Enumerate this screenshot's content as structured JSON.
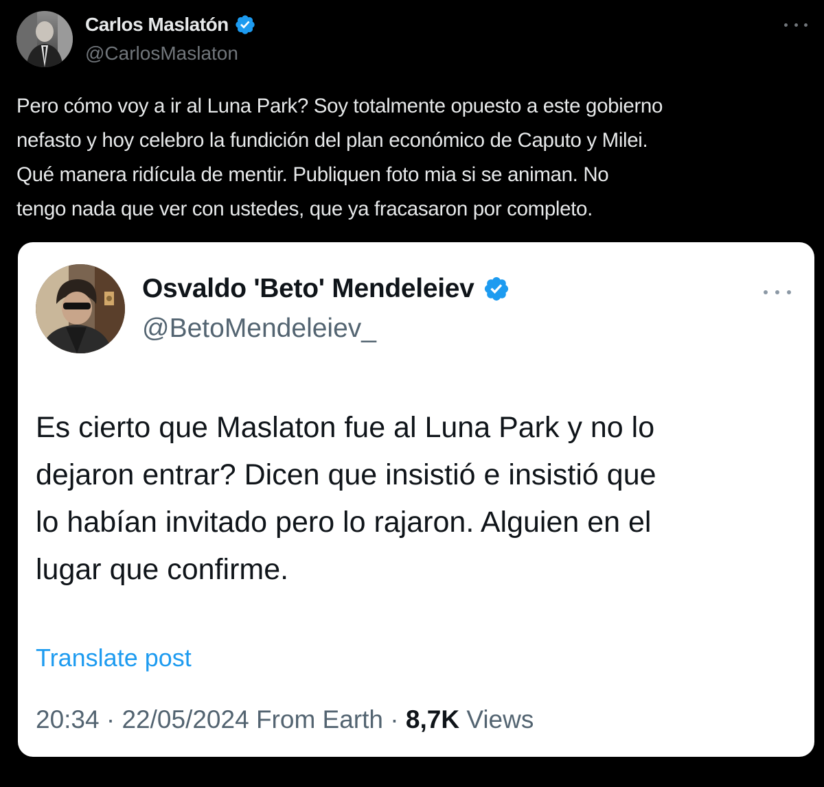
{
  "outer_post": {
    "author_name": "Carlos Maslatón",
    "author_handle": "@CarlosMaslaton",
    "verified_badge_color": "#1d9bf0",
    "more_icon": "more-horizontal-icon",
    "text": "Pero cómo voy a ir al Luna Park? Soy totalmente opuesto a este gobierno\nnefasto y hoy celebro la fundición del plan económico de Caputo y Milei.\nQué manera ridícula de mentir. Publiquen foto mia si se animan. No\ntengo nada que ver con ustedes, que ya fracasaron por completo."
  },
  "quoted_post": {
    "author_name": "Osvaldo 'Beto' Mendeleiev",
    "author_handle": "@BetoMendeleiev_",
    "verified_badge_color": "#1d9bf0",
    "more_icon": "more-horizontal-icon",
    "text": "Es cierto que Maslaton fue al Luna Park y no lo\ndejaron entrar? Dicen que insistió e insistió que\nlo habían invitado pero lo rajaron. Alguien en el\nlugar que confirme.",
    "translate_label": "Translate post",
    "time": "20:34",
    "separator": "·",
    "date": "22/05/2024",
    "source": "From Earth",
    "views_count": "8,7K",
    "views_label": "Views"
  },
  "colors": {
    "background": "#000000",
    "card_background": "#ffffff",
    "link": "#1d9bf0",
    "muted_dark": "#71767b",
    "muted_light": "#536471"
  }
}
